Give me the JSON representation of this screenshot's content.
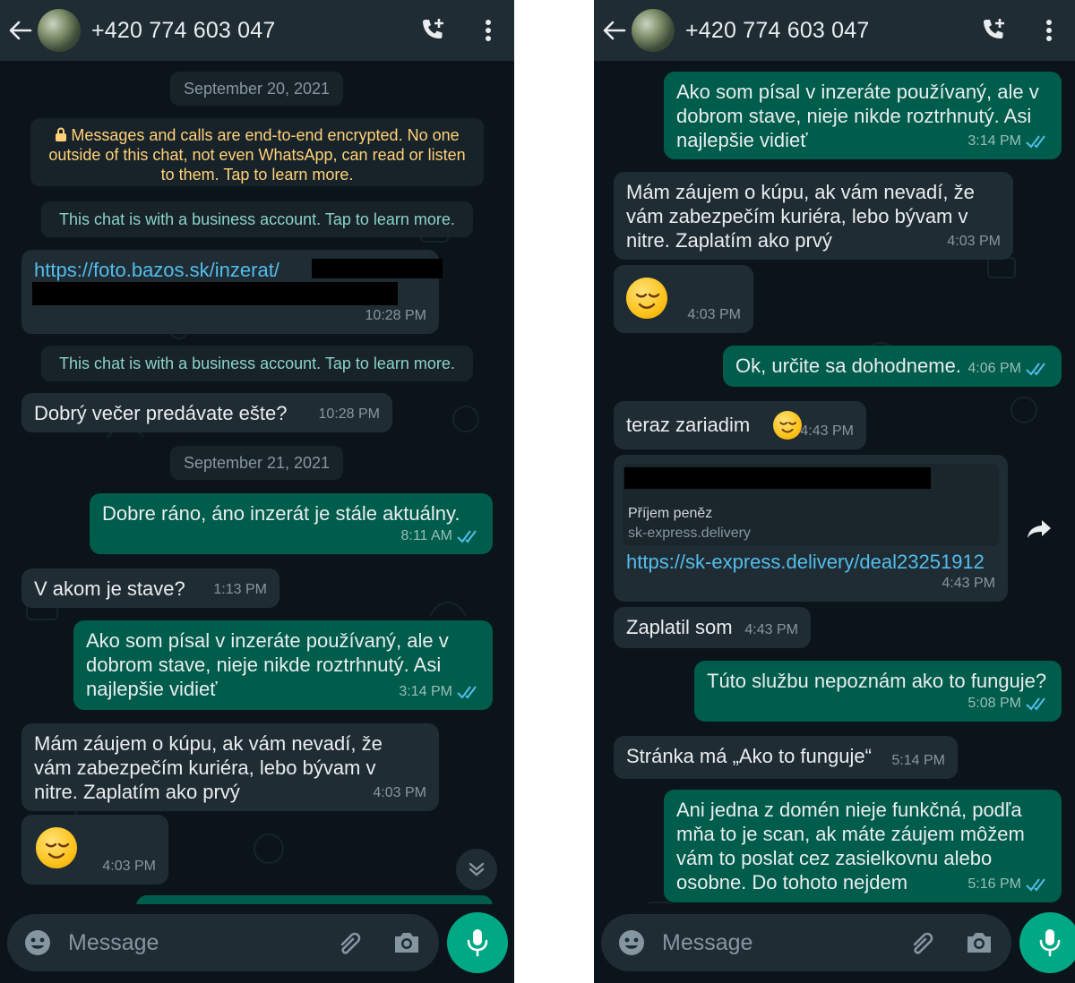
{
  "contact": {
    "name": "+420 774 603 047"
  },
  "left": {
    "dates": [
      "September 20, 2021",
      "September 21, 2021"
    ],
    "encryption_notice": "Messages and calls are end-to-end encrypted. No one outside of this chat, not even WhatsApp, can read or listen to them. Tap to learn more.",
    "business_notice": "This chat is with a business account. Tap to learn more.",
    "messages": [
      {
        "text": "https://foto.bazos.sk/inzerat/",
        "time": "10:28 PM"
      },
      {
        "text": "Dobrý večer predávate ešte?",
        "time": "10:28 PM"
      },
      {
        "text": "Dobre ráno, áno inzerát je stále aktuálny.",
        "time": "8:11 AM"
      },
      {
        "text": "V akom je stave?",
        "time": "1:13 PM"
      },
      {
        "text": "Ako som písal v inzeráte používaný, ale v\ndobrom stave, nieje nikde roztrhnutý. Asi\nnajlepšie vidieť",
        "time": "3:14 PM"
      },
      {
        "text": "Mám záujem o kúpu, ak vám nevadí, že\nvám zabezpečím kuriéra, lebo bývam v\nnitre. Zaplatím ako prvý",
        "time": "4:03 PM"
      },
      {
        "text": "",
        "time": "4:03 PM"
      }
    ]
  },
  "right": {
    "messages": [
      {
        "text": "Ako som písal v inzeráte používaný, ale v\ndobrom stave, nieje nikde roztrhnutý. Asi\nnajlepšie vidieť",
        "time": "3:14 PM"
      },
      {
        "text": "Mám záujem o kúpu, ak vám nevadí, že\nvám zabezpečím kuriéra, lebo bývam v\nnitre. Zaplatím ako prvý",
        "time": "4:03 PM"
      },
      {
        "text": "",
        "time": "4:03 PM"
      },
      {
        "text": "Ok, určite sa dohodneme.",
        "time": "4:06 PM"
      },
      {
        "text": "teraz zariadim",
        "time": "4:43 PM"
      },
      {
        "text": "https://sk-express.delivery/deal23251912",
        "time": "4:43 PM",
        "preview_title": "Příjem peněz",
        "preview_domain": "sk-express.delivery"
      },
      {
        "text": "Zaplatil som",
        "time": "4:43 PM"
      },
      {
        "text": "Túto službu nepoznám ako to funguje?",
        "time": "5:08 PM"
      },
      {
        "text": "Stránka má „Ako to funguje“",
        "time": "5:14 PM"
      },
      {
        "text": "Ani jedna z domén nieje funkčná, podľa\nmňa to je scan, ak máte záujem môžem\nvám to poslat cez zasielkovnu alebo\nosobne. Do tohoto nejdem",
        "time": "5:16 PM"
      }
    ]
  },
  "composer": {
    "placeholder": "Message"
  },
  "icons": [
    "back-arrow-icon",
    "add-call-icon",
    "menu-dots-icon",
    "emoji-icon",
    "attach-icon",
    "camera-icon",
    "mic-icon",
    "forward-icon",
    "chevron-down-icon",
    "double-check-icon",
    "lock-icon"
  ],
  "colors": {
    "background": "#0b141a",
    "bar": "#1f2c34",
    "incoming": "#202c33",
    "outgoing": "#005c4b",
    "accent": "#00a884",
    "link": "#53bdeb"
  }
}
